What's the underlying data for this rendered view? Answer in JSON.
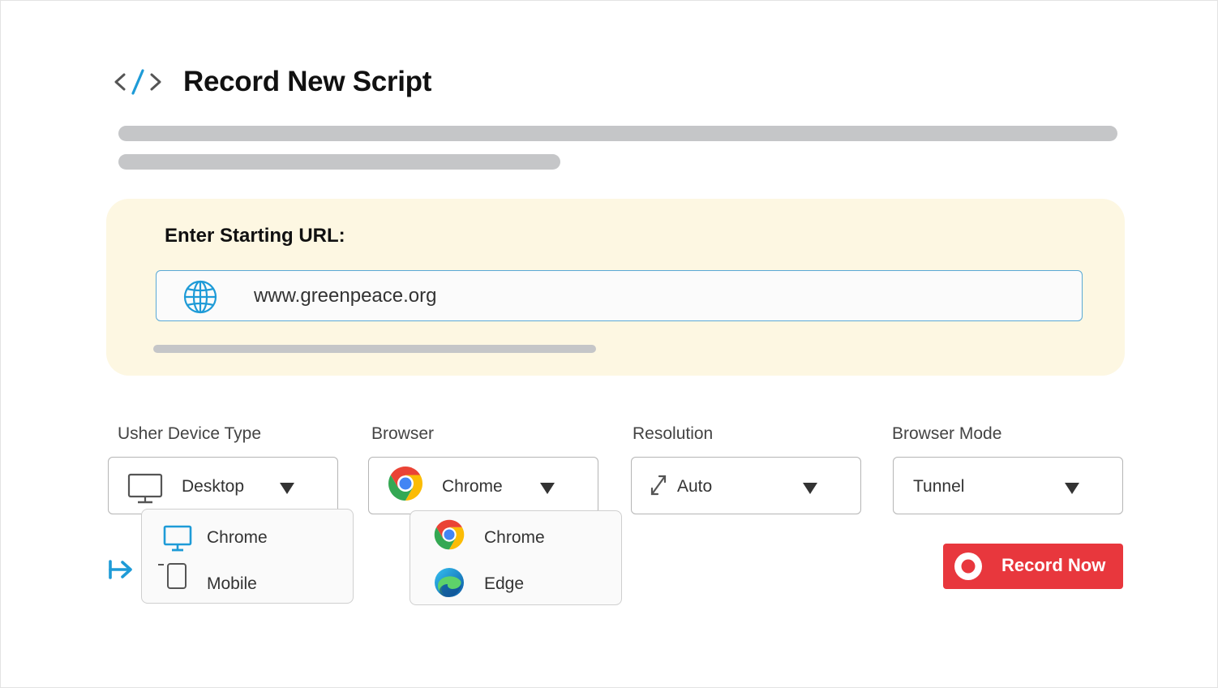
{
  "header": {
    "title": "Record New Script",
    "icon": "code-icon"
  },
  "url_panel": {
    "label": "Enter Starting URL:",
    "value": "www.greenpeace.org",
    "icon": "globe-icon"
  },
  "fields": {
    "device_type": {
      "label": "Usher Device Type",
      "value": "Desktop",
      "icon": "monitor-icon"
    },
    "browser": {
      "label": "Browser",
      "value": "Chrome",
      "icon": "chrome-icon"
    },
    "resolution": {
      "label": "Resolution",
      "value": "Auto",
      "icon": "resize-icon"
    },
    "browser_mode": {
      "label": "Browser Mode",
      "value": "Tunnel"
    }
  },
  "device_dropdown": {
    "items": [
      {
        "label": "Chrome",
        "icon": "monitor-icon"
      },
      {
        "label": "Mobile",
        "icon": "mobile-icon"
      }
    ]
  },
  "browser_dropdown": {
    "items": [
      {
        "label": "Chrome",
        "icon": "chrome-icon"
      },
      {
        "label": "Edge",
        "icon": "edge-icon"
      }
    ]
  },
  "record_button": {
    "label": "Record Now",
    "icon": "record-icon"
  },
  "colors": {
    "accent_blue": "#1e9bd7",
    "record_red": "#e8373d",
    "panel_bg": "#fdf7e2",
    "skeleton": "#c5c6c8"
  }
}
